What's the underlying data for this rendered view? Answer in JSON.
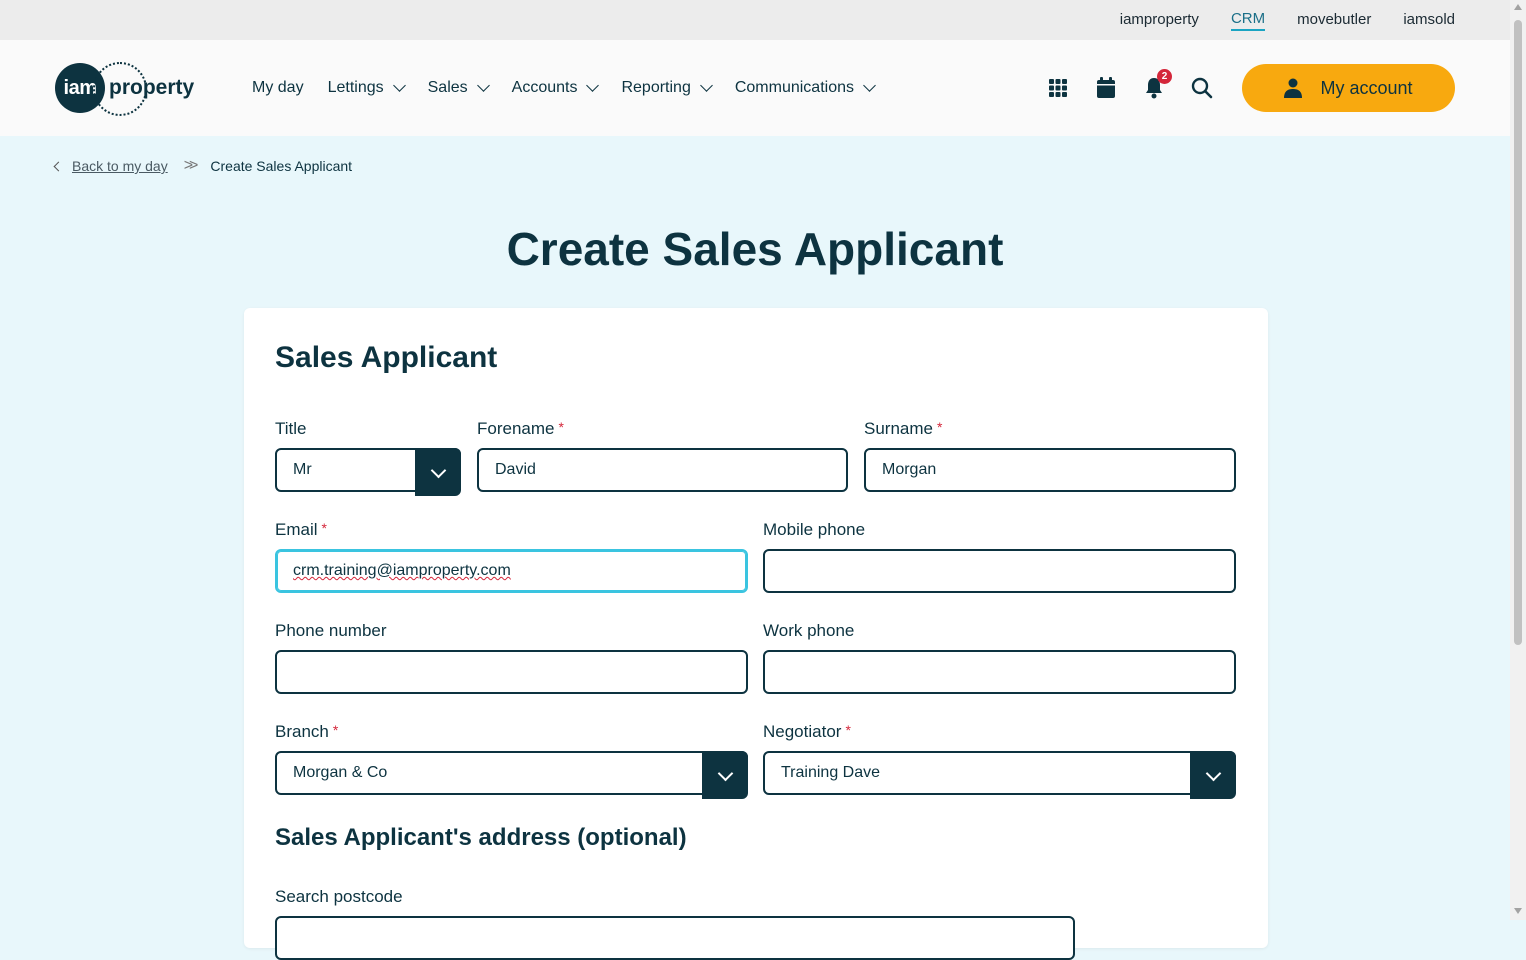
{
  "topbar": {
    "links": [
      "iamproperty",
      "CRM",
      "movebutler",
      "iamsold"
    ],
    "active": "CRM"
  },
  "header": {
    "logo": {
      "badge": "iam",
      "text": "property"
    },
    "nav": [
      "My day",
      "Lettings",
      "Sales",
      "Accounts",
      "Reporting",
      "Communications"
    ],
    "notification_count": "2",
    "account_label": "My account",
    "colors": {
      "brand": "#0d3340",
      "accent": "#f8a90f",
      "badge": "#d4263a"
    }
  },
  "breadcrumb": {
    "back": "Back to my day",
    "current": "Create Sales Applicant"
  },
  "page": {
    "title": "Create Sales Applicant"
  },
  "form": {
    "heading": "Sales Applicant",
    "title": {
      "label": "Title",
      "value": "Mr"
    },
    "forename": {
      "label": "Forename",
      "value": "David",
      "required": "*"
    },
    "surname": {
      "label": "Surname",
      "value": "Morgan",
      "required": "*"
    },
    "email": {
      "label": "Email",
      "value": "crm.training@iamproperty.com",
      "required": "*"
    },
    "mobile": {
      "label": "Mobile phone",
      "value": ""
    },
    "phone": {
      "label": "Phone number",
      "value": ""
    },
    "work": {
      "label": "Work phone",
      "value": ""
    },
    "branch": {
      "label": "Branch",
      "value": "Morgan & Co",
      "required": "*"
    },
    "negotiator": {
      "label": "Negotiator",
      "value": "Training Dave",
      "required": "*"
    },
    "address_heading": "Sales Applicant's address (optional)",
    "postcode_label": "Search postcode"
  }
}
